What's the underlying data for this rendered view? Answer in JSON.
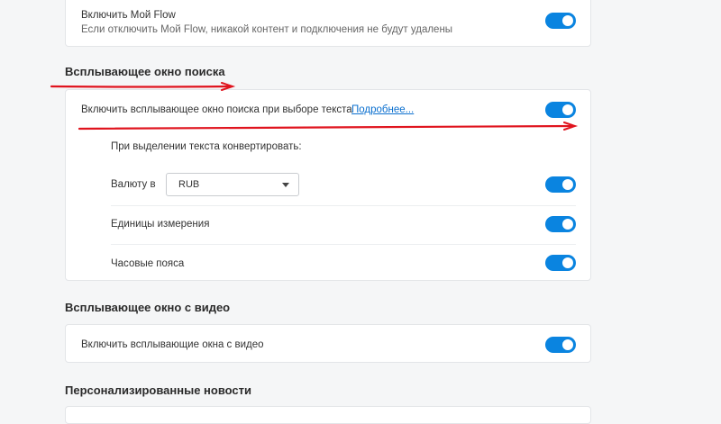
{
  "my_flow": {
    "title": "Включить Мой Flow",
    "description": "Если отключить Мой Flow, никакой контент и подключения не будут удалены"
  },
  "search_popup": {
    "section_title": "Всплывающее окно поиска",
    "enable_label": "Включить всплывающее окно поиска при выборе текста",
    "learn_more": "Подробнее...",
    "convert_label": "При выделении текста конвертировать:",
    "currency_label": "Валюту в",
    "currency_value": "RUB",
    "units_label": "Единицы измерения",
    "timezones_label": "Часовые пояса"
  },
  "video_popup": {
    "section_title": "Всплывающее окно с видео",
    "enable_label": "Включить всплывающие окна с видео"
  },
  "news": {
    "section_title": "Персонализированные новости"
  },
  "colors": {
    "accent": "#0a84e0",
    "annotation": "#e0141e",
    "background": "#f5f6f7"
  },
  "toggles": {
    "my_flow": true,
    "search_popup": true,
    "currency": true,
    "units": true,
    "timezones": true,
    "video_popup": true
  }
}
